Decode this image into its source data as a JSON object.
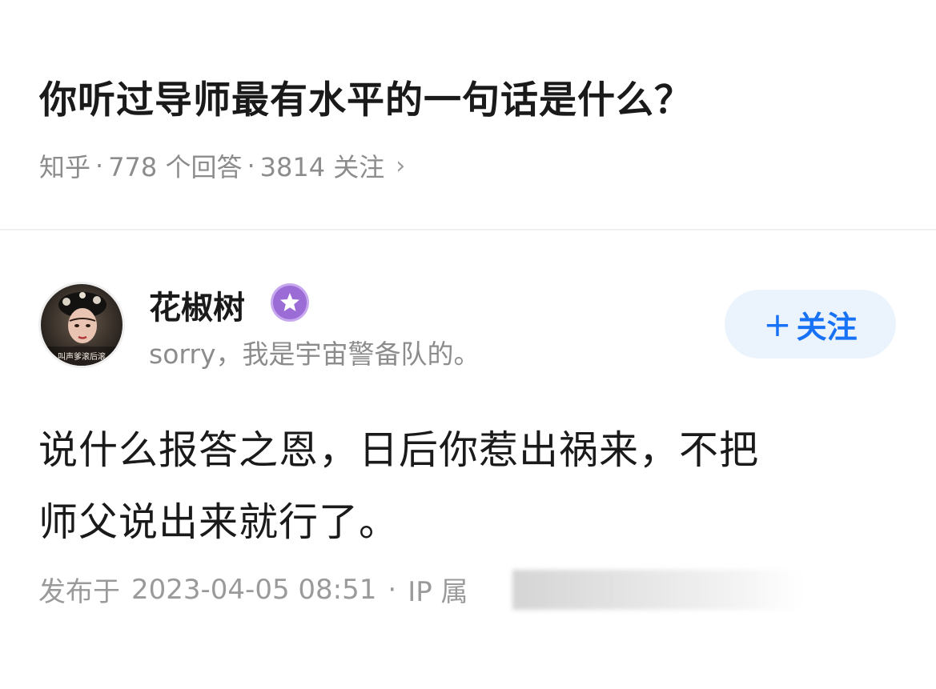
{
  "question": {
    "title": "你听过导师最有水平的一句话是什么？",
    "source": "知乎",
    "answers_count": "778 个回答",
    "followers_count": "3814 关注",
    "separator": "·",
    "chevron": "›"
  },
  "author": {
    "name": "花椒树",
    "bio": "sorry，我是宇宙警备队的。",
    "badge_icon": "star-badge-icon",
    "avatar_caption": "叫声爹滚后滚",
    "colors": {
      "badge": "#9b6bd6"
    }
  },
  "follow_button": {
    "plus": "+",
    "label": "关注",
    "color": "#1772f6",
    "background": "#ebf3fc"
  },
  "answer": {
    "lines": [
      "说什么报答之恩，日后你惹出祸来，不把",
      "师父说出来就行了。"
    ]
  },
  "publish": {
    "prefix": "发布于",
    "datetime": "2023-04-05 08:51",
    "separator": "·",
    "ip_label": "IP 属"
  }
}
